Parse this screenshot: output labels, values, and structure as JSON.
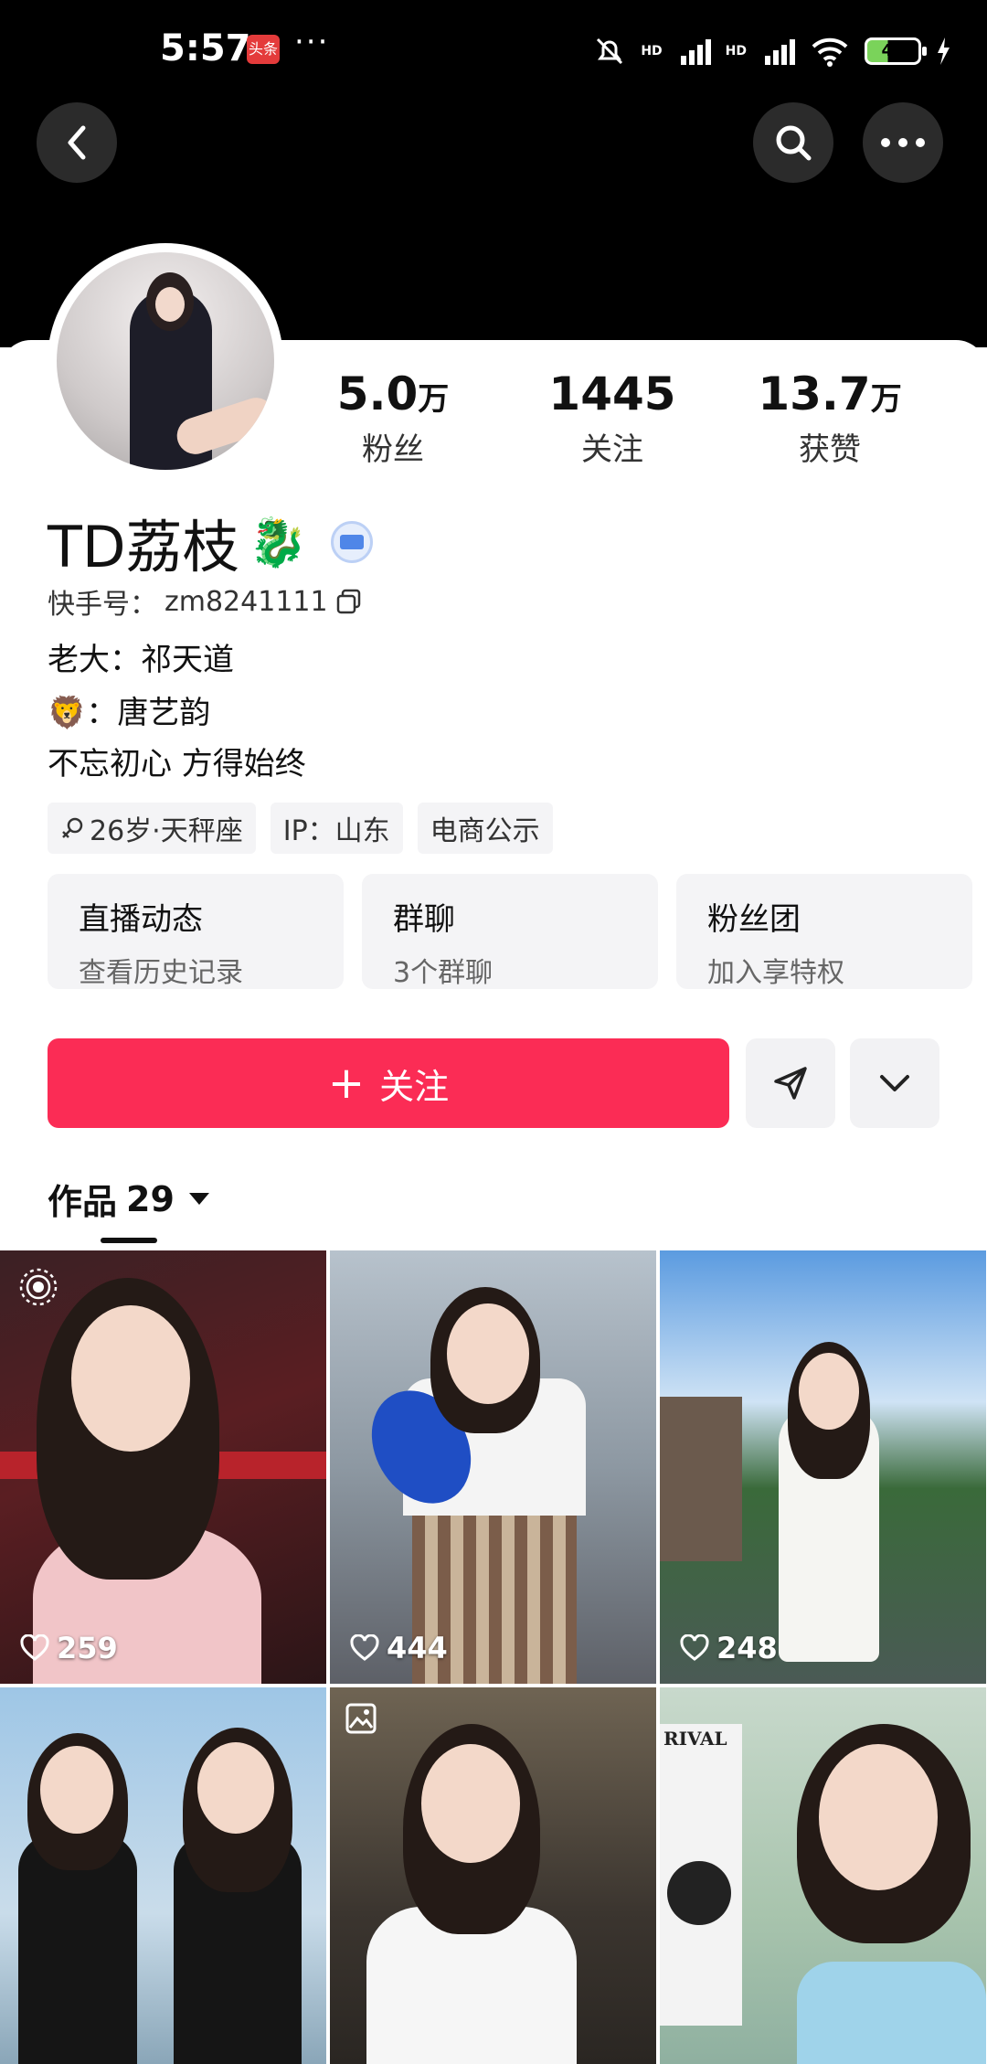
{
  "status_bar": {
    "time": "5:57",
    "app_badge": "头条",
    "more": "···",
    "hd1": "HD",
    "hd2": "HD",
    "battery": "40"
  },
  "profile": {
    "name": "TD荔枝",
    "name_emoji": "🐉",
    "kuaishou_id_label": "快手号：",
    "kuaishou_id": "zm8241111",
    "bio": [
      "老大：祁天道",
      "🦁：唐艺韵",
      "不忘初心 方得始终"
    ],
    "tags": [
      "26岁·天秤座",
      "IP：山东",
      "电商公示"
    ]
  },
  "stats": [
    {
      "num": "5.0",
      "unit": "万",
      "label": "粉丝"
    },
    {
      "num": "1445",
      "unit": "",
      "label": "关注"
    },
    {
      "num": "13.7",
      "unit": "万",
      "label": "获赞"
    }
  ],
  "feature_boxes": [
    {
      "title": "直播动态",
      "sub": "查看历史记录"
    },
    {
      "title": "群聊",
      "sub": "3个群聊"
    },
    {
      "title": "粉丝团",
      "sub": "加入享特权"
    }
  ],
  "actions": {
    "follow_plus": "+",
    "follow": "关注"
  },
  "works": {
    "label": "作品",
    "count": "29"
  },
  "posts": [
    {
      "likes": "259"
    },
    {
      "likes": "444"
    },
    {
      "likes": "248"
    },
    {
      "likes": ""
    },
    {
      "likes": ""
    },
    {
      "likes": "",
      "overlay_text": "RIVAL"
    }
  ],
  "colors": {
    "accent": "#fb2c55",
    "header": "#000000"
  }
}
